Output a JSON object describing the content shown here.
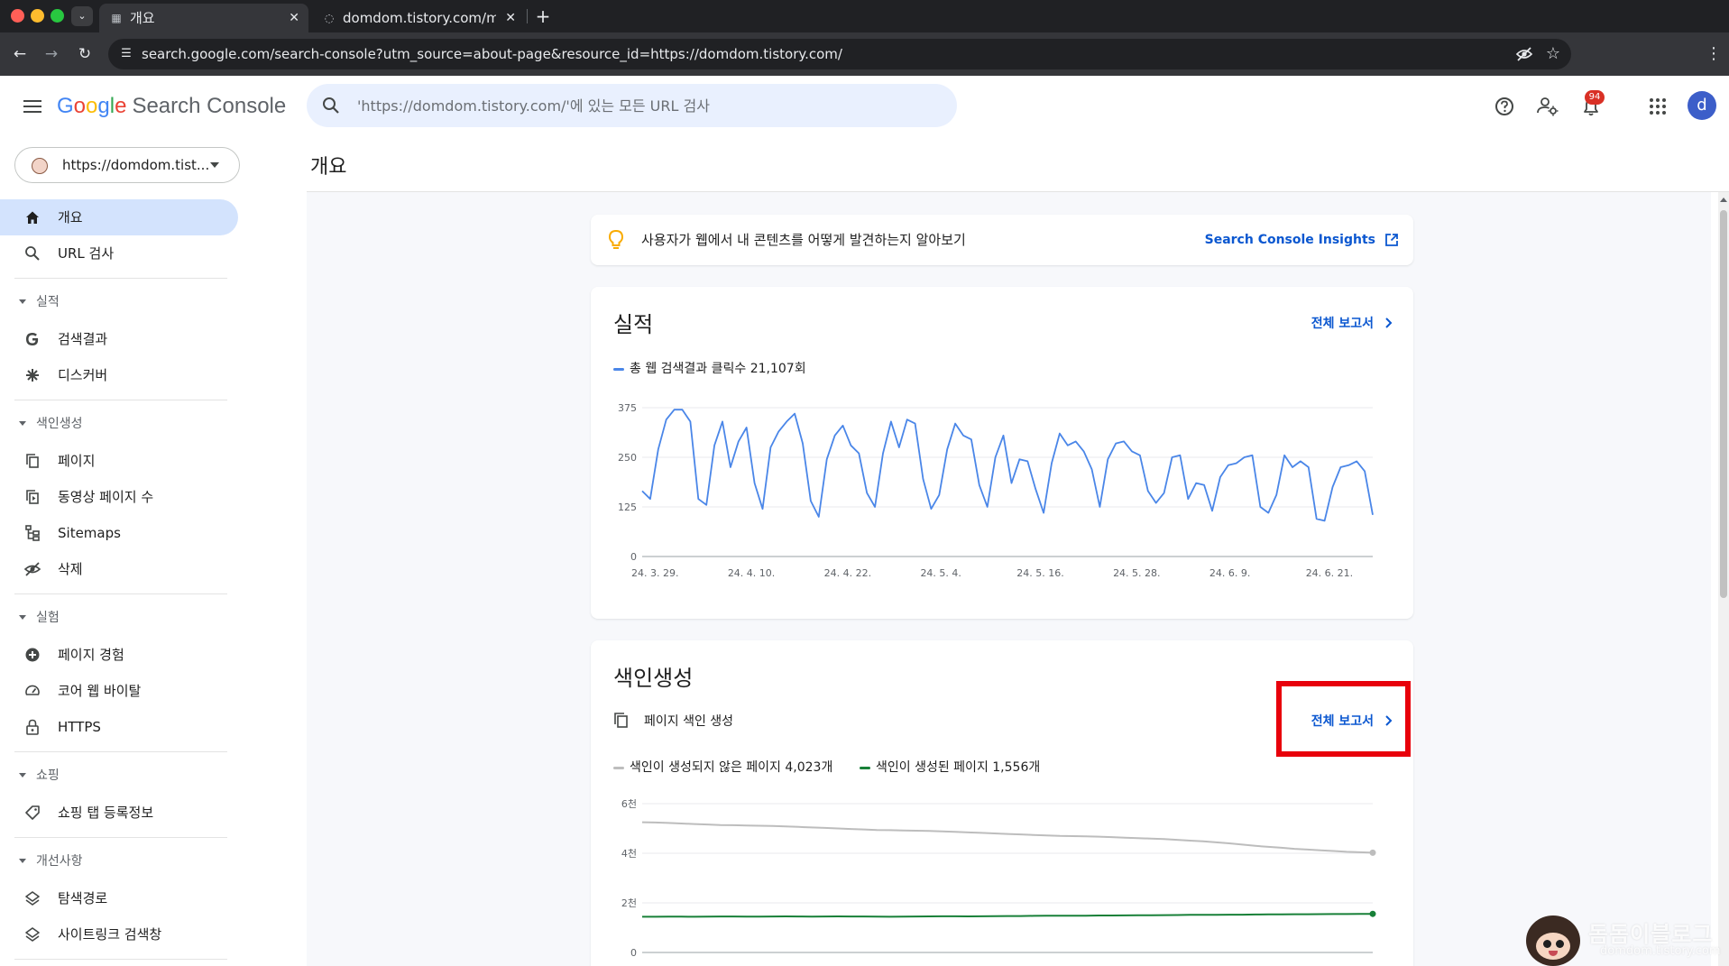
{
  "browser": {
    "tabs": [
      {
        "title": "개요",
        "active": true
      },
      {
        "title": "domdom.tistory.com/m",
        "active": false
      }
    ],
    "url": "search.google.com/search-console?utm_source=about-page&resource_id=https://domdom.tistory.com/",
    "colors": {
      "chrome_dark": "#202124",
      "chrome_mid": "#35363a"
    }
  },
  "header": {
    "logo_parts": [
      "G",
      "o",
      "o",
      "g",
      "l",
      "e"
    ],
    "product": "Search Console",
    "search_placeholder": "'https://domdom.tistory.com/'에 있는 모든 URL 검사",
    "notification_count": "94",
    "avatar_letter": "d"
  },
  "sidebar": {
    "property": "https://domdom.tist...",
    "top_items": [
      {
        "label": "개요",
        "icon": "home-icon",
        "active": true
      },
      {
        "label": "URL 검사",
        "icon": "search-icon",
        "active": false
      }
    ],
    "sections": [
      {
        "title": "실적",
        "items": [
          {
            "label": "검색결과",
            "icon": "google-g-icon"
          },
          {
            "label": "디스커버",
            "icon": "asterisk-icon"
          }
        ]
      },
      {
        "title": "색인생성",
        "items": [
          {
            "label": "페이지",
            "icon": "pages-icon"
          },
          {
            "label": "동영상 페이지 수",
            "icon": "video-pages-icon"
          },
          {
            "label": "Sitemaps",
            "icon": "sitemap-icon"
          },
          {
            "label": "삭제",
            "icon": "eye-off-icon"
          }
        ]
      },
      {
        "title": "실험",
        "items": [
          {
            "label": "페이지 경험",
            "icon": "plus-circle-icon"
          },
          {
            "label": "코어 웹 바이탈",
            "icon": "gauge-icon"
          },
          {
            "label": "HTTPS",
            "icon": "lock-icon"
          }
        ]
      },
      {
        "title": "쇼핑",
        "items": [
          {
            "label": "쇼핑 탭 등록정보",
            "icon": "tag-icon"
          }
        ]
      },
      {
        "title": "개선사항",
        "items": [
          {
            "label": "탐색경로",
            "icon": "layers-icon"
          },
          {
            "label": "사이트링크 검색창",
            "icon": "layers-icon"
          }
        ]
      }
    ],
    "colors": {
      "active_bg": "#d3e3fd"
    }
  },
  "main": {
    "page_title": "개요",
    "insight": {
      "text": "사용자가 웹에서 내 콘텐츠를 어떻게 발견하는지 알아보기",
      "link": "Search Console Insights"
    },
    "performance": {
      "title": "실적",
      "report_link": "전체 보고서",
      "legend": "총 웹 검색결과 클릭수 21,107회"
    },
    "indexing": {
      "title": "색인생성",
      "report_link": "전체 보고서",
      "subtitle": "페이지 색인 생성",
      "legend_not_indexed": "색인이 생성되지 않은 페이지 4,023개",
      "legend_indexed": "색인이 생성된 페이지 1,556개"
    },
    "colors": {
      "link": "#0b57d0",
      "clicks_line": "#4a86e8",
      "indexed_line": "#188038",
      "not_indexed_line": "#bdbdbd",
      "highlight": "#e8000b"
    }
  },
  "watermark": {
    "title": "돔돔이블로그",
    "subtitle": "domdom.tistory.com"
  },
  "chart_data": [
    {
      "type": "line",
      "ylim": [
        0,
        375
      ],
      "yticks": [
        "0",
        "125",
        "250",
        "375"
      ],
      "x_tick_labels": [
        "24. 3. 29.",
        "24. 4. 10.",
        "24. 4. 22.",
        "24. 5. 4.",
        "24. 5. 16.",
        "24. 5. 28.",
        "24. 6. 9.",
        "24. 6. 21."
      ],
      "series": [
        {
          "name": "총 웹 검색결과 클릭수 21,107회",
          "values": [
            165,
            145,
            270,
            345,
            370,
            370,
            340,
            145,
            130,
            280,
            340,
            225,
            290,
            325,
            185,
            120,
            275,
            315,
            340,
            360,
            285,
            140,
            100,
            245,
            305,
            330,
            280,
            260,
            160,
            125,
            260,
            340,
            275,
            345,
            335,
            195,
            120,
            155,
            270,
            335,
            305,
            295,
            180,
            125,
            250,
            305,
            185,
            245,
            240,
            170,
            110,
            235,
            310,
            280,
            290,
            265,
            220,
            125,
            245,
            285,
            290,
            265,
            255,
            165,
            135,
            160,
            250,
            255,
            145,
            185,
            180,
            115,
            200,
            230,
            235,
            250,
            255,
            125,
            110,
            155,
            255,
            225,
            240,
            225,
            95,
            90,
            175,
            225,
            230,
            240,
            215,
            105
          ]
        }
      ]
    },
    {
      "type": "line",
      "ylim": [
        0,
        6000
      ],
      "yticks": [
        "0",
        "2천",
        "4천",
        "6천"
      ],
      "series": [
        {
          "name": "색인이 생성되지 않은 페이지 4,023개",
          "values": [
            5250,
            5240,
            5220,
            5200,
            5180,
            5160,
            5140,
            5130,
            5120,
            5110,
            5100,
            5080,
            5060,
            5040,
            5020,
            5000,
            4980,
            4960,
            4940,
            4930,
            4920,
            4910,
            4900,
            4880,
            4860,
            4840,
            4820,
            4800,
            4780,
            4760,
            4740,
            4720,
            4700,
            4690,
            4680,
            4670,
            4650,
            4630,
            4610,
            4590,
            4570,
            4540,
            4510,
            4480,
            4440,
            4400,
            4350,
            4300,
            4260,
            4220,
            4180,
            4150,
            4120,
            4090,
            4060,
            4040,
            4023
          ]
        },
        {
          "name": "색인이 생성된 페이지 1,556개",
          "values": [
            1440,
            1440,
            1445,
            1445,
            1440,
            1445,
            1450,
            1450,
            1445,
            1445,
            1450,
            1455,
            1450,
            1445,
            1450,
            1455,
            1450,
            1450,
            1445,
            1440,
            1445,
            1450,
            1455,
            1460,
            1460,
            1455,
            1460,
            1465,
            1470,
            1470,
            1475,
            1480,
            1480,
            1485,
            1485,
            1490,
            1490,
            1495,
            1500,
            1500,
            1505,
            1510,
            1515,
            1515,
            1520,
            1525,
            1525,
            1530,
            1535,
            1535,
            1540,
            1540,
            1545,
            1550,
            1550,
            1555,
            1556
          ]
        }
      ]
    }
  ]
}
